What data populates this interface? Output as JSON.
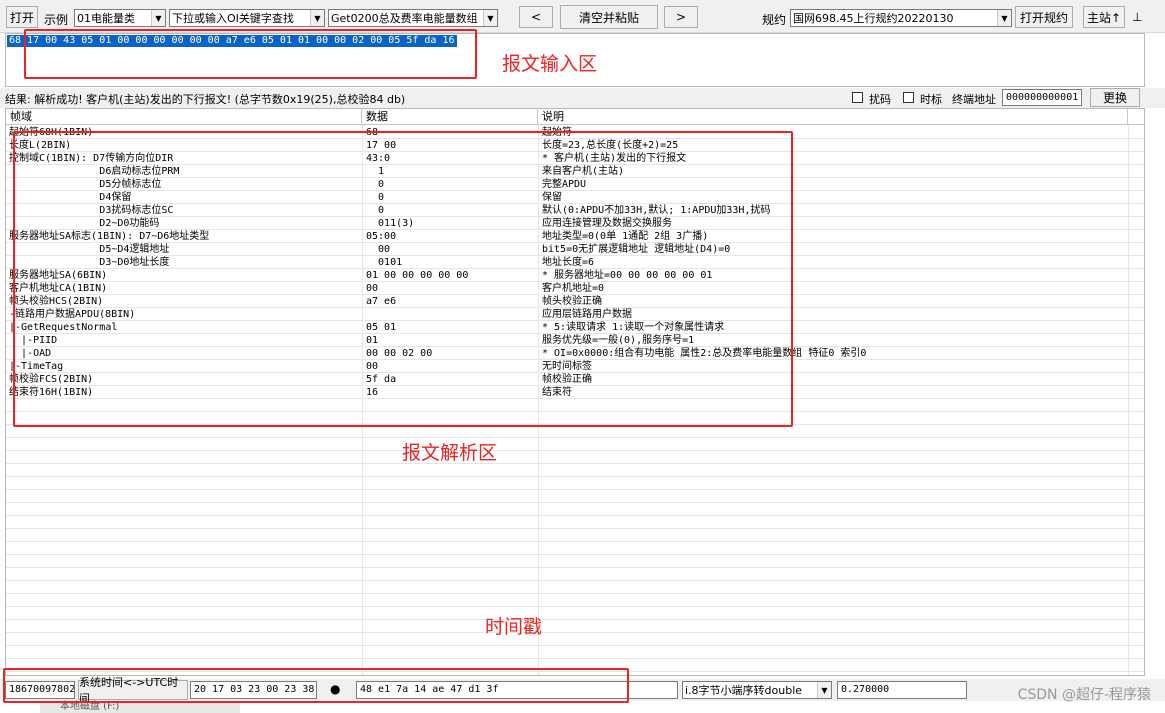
{
  "toolbar": {
    "open_label": "打开",
    "example_label": "示例",
    "example_value": "01电能量类",
    "oi_search_value": "下拉或输入OI关键字查找",
    "get_value": "Get0200总及费率电能量数组",
    "prev_label": "<",
    "clear_paste_label": "清空并粘贴",
    "next_label": ">",
    "protocol_label": "规约",
    "protocol_value": "国网698.45上行规约20220130",
    "open_protocol_label": "打开规约",
    "master_label": "主站↑",
    "pin_label": "⊥"
  },
  "input": {
    "hex_text": "68 17 00 43 05 01 00 00 00 00 00 00 a7 e6 05 01 01 00 00 02 00 05 5f da 16"
  },
  "status": {
    "result_text": "结果: 解析成功! 客户机(主站)发出的下行报文! (总字节数0x19(25),总校验84 db)",
    "scramble_label": "扰码",
    "timestamp_label": "时标",
    "terminal_addr_label": "终端地址",
    "terminal_addr_value": "000000000001",
    "replace_label": "更换"
  },
  "grid": {
    "columns": [
      "帧域",
      "数据",
      "说明"
    ],
    "rows": [
      [
        "起始符68H(1BIN)",
        "68",
        "起始符"
      ],
      [
        "长度L(2BIN)",
        "17 00",
        "长度=23,总长度(长度+2)=25"
      ],
      [
        "控制域C(1BIN): D7传输方向位DIR",
        "43:0",
        "* 客户机(主站)发出的下行报文"
      ],
      [
        "               D6启动标志位PRM",
        "  1",
        "来自客户机(主站)"
      ],
      [
        "               D5分帧标志位",
        "  0",
        "完整APDU"
      ],
      [
        "               D4保留",
        "  0",
        "保留"
      ],
      [
        "               D3扰码标志位SC",
        "  0",
        "默认(0:APDU不加33H,默认; 1:APDU加33H,扰码"
      ],
      [
        "               D2~D0功能码",
        "  011(3)",
        "应用连接管理及数据交换服务"
      ],
      [
        "服务器地址SA标志(1BIN): D7~D6地址类型",
        "05:00",
        "地址类型=0(0单 1通配 2组 3广播)"
      ],
      [
        "               D5~D4逻辑地址",
        "  00",
        "bit5=0无扩展逻辑地址 逻辑地址(D4)=0"
      ],
      [
        "               D3~D0地址长度",
        "  0101",
        "地址长度=6"
      ],
      [
        "服务器地址SA(6BIN)",
        "01 00 00 00 00 00",
        "* 服务器地址=00 00 00 00 00 01"
      ],
      [
        "客户机地址CA(1BIN)",
        "00",
        "客户机地址=0"
      ],
      [
        "帧头校验HCS(2BIN)",
        "a7 e6",
        "帧头校验正确"
      ],
      [
        "-链路用户数据APDU(8BIN)",
        "",
        "应用层链路用户数据"
      ],
      [
        "|-GetRequestNormal",
        "05 01",
        "* 5:读取请求 1:读取一个对象属性请求"
      ],
      [
        "  |-PIID",
        "01",
        "服务优先级=一般(0),服务序号=1"
      ],
      [
        "  |-OAD",
        "00 00 02 00",
        "* OI=0x0000:组合有功电能 属性2:总及费率电能量数组 特征0 索引0"
      ],
      [
        "|-TimeTag",
        "00",
        "无时间标签"
      ],
      [
        "帧校验FCS(2BIN)",
        "5f da",
        "帧校验正确"
      ],
      [
        "结束符16H(1BIN)",
        "16",
        "结束符"
      ]
    ]
  },
  "bottom": {
    "counter_value": "18670097802",
    "time_convert_label": "系统时间<->UTC时间",
    "time_value": "20 17 03 23 00 23 38",
    "dot_label": "●",
    "hex_value": "48 e1 7a 14 ae 47 d1 3f",
    "convert_mode_value": "i.8字节小端序转double",
    "result_value": "0.270000"
  },
  "annotations": {
    "input_area": "报文输入区",
    "parse_area": "报文解析区",
    "timestamp": "时间戳"
  },
  "watermark": "CSDN @超仔-程序猿",
  "taskbar_item": "本地磁盘 (F:)",
  "colors": {
    "annotation": "#ee2222",
    "selection": "#0a64c8",
    "toolbar_bg": "#f0f0f0"
  }
}
